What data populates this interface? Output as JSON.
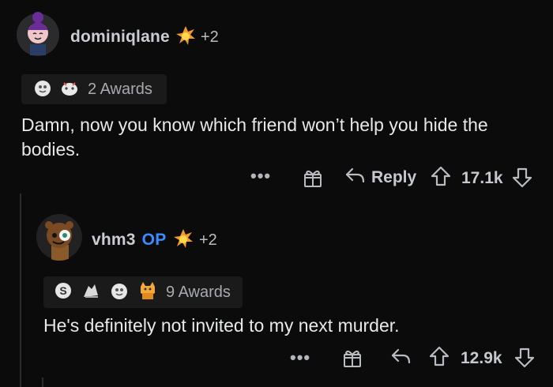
{
  "comments": [
    {
      "username": "dominiqlane",
      "flair_extra": "+2",
      "awards_label": "2 Awards",
      "body": "Damn, now you know which friend won’t help you hide the bodies.",
      "reply_label": "Reply",
      "votes": "17.1k"
    },
    {
      "username": "vhm3",
      "op_badge": "OP",
      "flair_extra": "+2",
      "awards_label": "9 Awards",
      "body": "He's definitely not invited to my next murder.",
      "votes": "12.9k"
    }
  ],
  "icons": {
    "more": "more-dots-icon",
    "gift": "gift-award-icon",
    "reply": "reply-arrow-icon",
    "upvote": "upvote-icon",
    "downvote": "downvote-icon",
    "flair": "explosion-flair-icon"
  },
  "colors": {
    "background": "#0b0b0c",
    "op_badge": "#3b8cff",
    "text": "#e6e8ea"
  }
}
